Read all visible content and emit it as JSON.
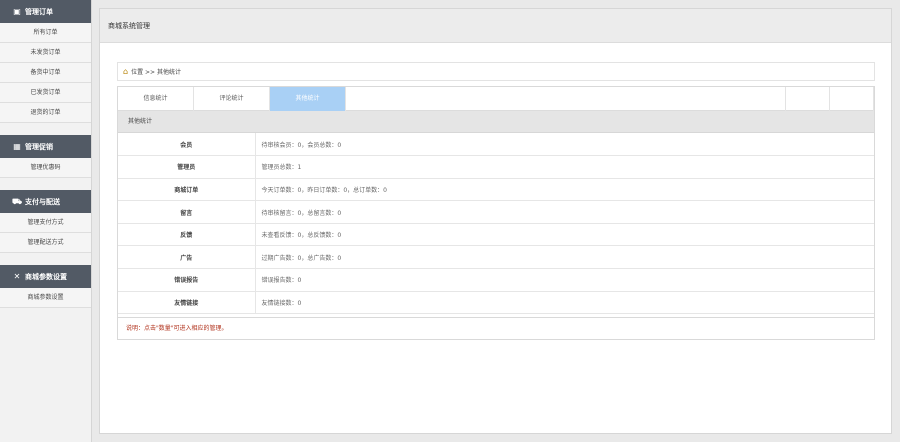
{
  "sidebar": {
    "groups": [
      {
        "title": "管理订单",
        "icon": "orders-icon",
        "items": [
          "所有订单",
          "未发货订单",
          "备货中订单",
          "已发货订单",
          "退货的订单"
        ]
      },
      {
        "title": "管理促销",
        "icon": "calendar-icon",
        "items": [
          "管理优惠码"
        ]
      },
      {
        "title": "支付与配送",
        "icon": "cart-icon",
        "items": [
          "管理支付方式",
          "管理配送方式"
        ]
      },
      {
        "title": "商城参数设置",
        "icon": "tools-icon",
        "items": [
          "商城参数设置"
        ]
      }
    ]
  },
  "header": {
    "title": "商城系统管理"
  },
  "breadcrumb": {
    "text": "位置 >> 其他统计"
  },
  "tabs": [
    "信息统计",
    "评论统计",
    "其他统计",
    "",
    ""
  ],
  "section": {
    "title": "其他统计"
  },
  "rows": [
    {
      "label": "会员",
      "value": "待审核会员：0，会员总数：0"
    },
    {
      "label": "管理员",
      "value": "管理员总数：1"
    },
    {
      "label": "商城订单",
      "value": "今天订单数：0，昨日订单数：0，总订单数：0"
    },
    {
      "label": "留言",
      "value": "待审核留言：0，总留言数：0"
    },
    {
      "label": "反馈",
      "value": "未查看反馈：0，总反馈数：0"
    },
    {
      "label": "广告",
      "value": "过期广告数：0，总广告数：0"
    },
    {
      "label": "错误报告",
      "value": "错误报告数：0"
    },
    {
      "label": "友情链接",
      "value": "友情链接数：0"
    }
  ],
  "note": {
    "text": "说明：点击\"数量\"可进入相应的管理。"
  },
  "colors": {
    "sidebar_header": "#525a65",
    "active_tab": "#a9d0f5",
    "note": "#b0301a"
  }
}
